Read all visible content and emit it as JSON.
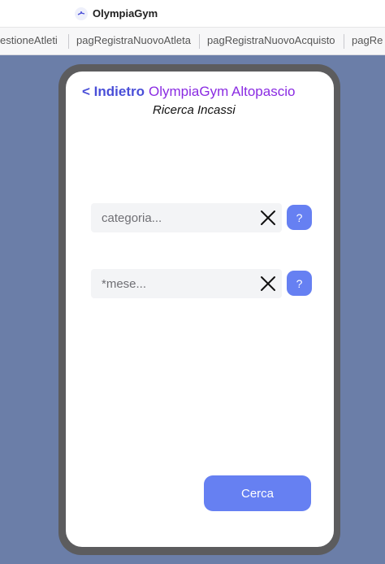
{
  "app": {
    "title": "OlympiaGym"
  },
  "tabs": [
    {
      "label": "estioneAtleti"
    },
    {
      "label": "pagRegistraNuovoAtleta"
    },
    {
      "label": "pagRegistraNuovoAcquisto"
    },
    {
      "label": "pagRe"
    }
  ],
  "header": {
    "back_label": "< Indietro",
    "gym_name": "OlympiaGym Altopascio",
    "subtitle": "Ricerca Incassi"
  },
  "form": {
    "category_placeholder": "categoria...",
    "category_value": "",
    "month_placeholder": "*mese...",
    "month_value": "",
    "help_label": "?",
    "search_label": "Cerca"
  },
  "colors": {
    "background": "#6b7ea8",
    "accent": "#6680f2",
    "back_link": "#4a4fd8",
    "gym_name": "#8a2be2",
    "frame": "#5c5c5e"
  },
  "icons": {
    "logo": "olympiagym-logo-icon",
    "clear": "close-icon",
    "help": "question-icon"
  }
}
